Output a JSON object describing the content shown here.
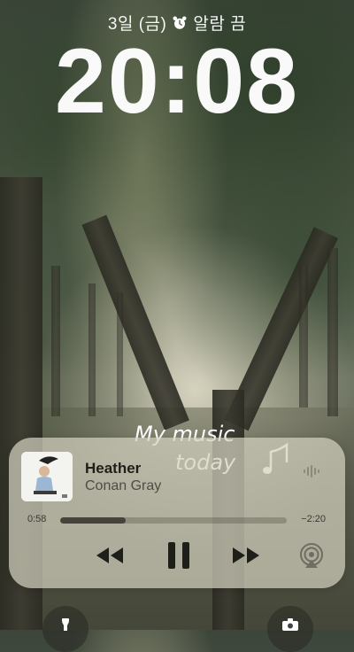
{
  "lockscreen": {
    "date_line": "3일 (금)",
    "alarm_text": "알람 끔",
    "time": "20:08"
  },
  "overlay": {
    "handwriting_line1": "My music",
    "handwriting_line2": "today"
  },
  "now_playing": {
    "title": "Heather",
    "artist": "Conan Gray",
    "elapsed": "0:58",
    "remaining": "−2:20",
    "progress_fraction": 0.29
  },
  "icons": {
    "alarm": "alarm-clock-icon",
    "waveform": "waveform-icon",
    "rewind": "rewind-icon",
    "pause": "pause-icon",
    "forward": "fast-forward-icon",
    "airplay": "airplay-icon",
    "flashlight": "flashlight-icon",
    "camera": "camera-icon"
  },
  "colors": {
    "player_bg": "#d2d0be",
    "text_dark": "#1f1f1a"
  }
}
